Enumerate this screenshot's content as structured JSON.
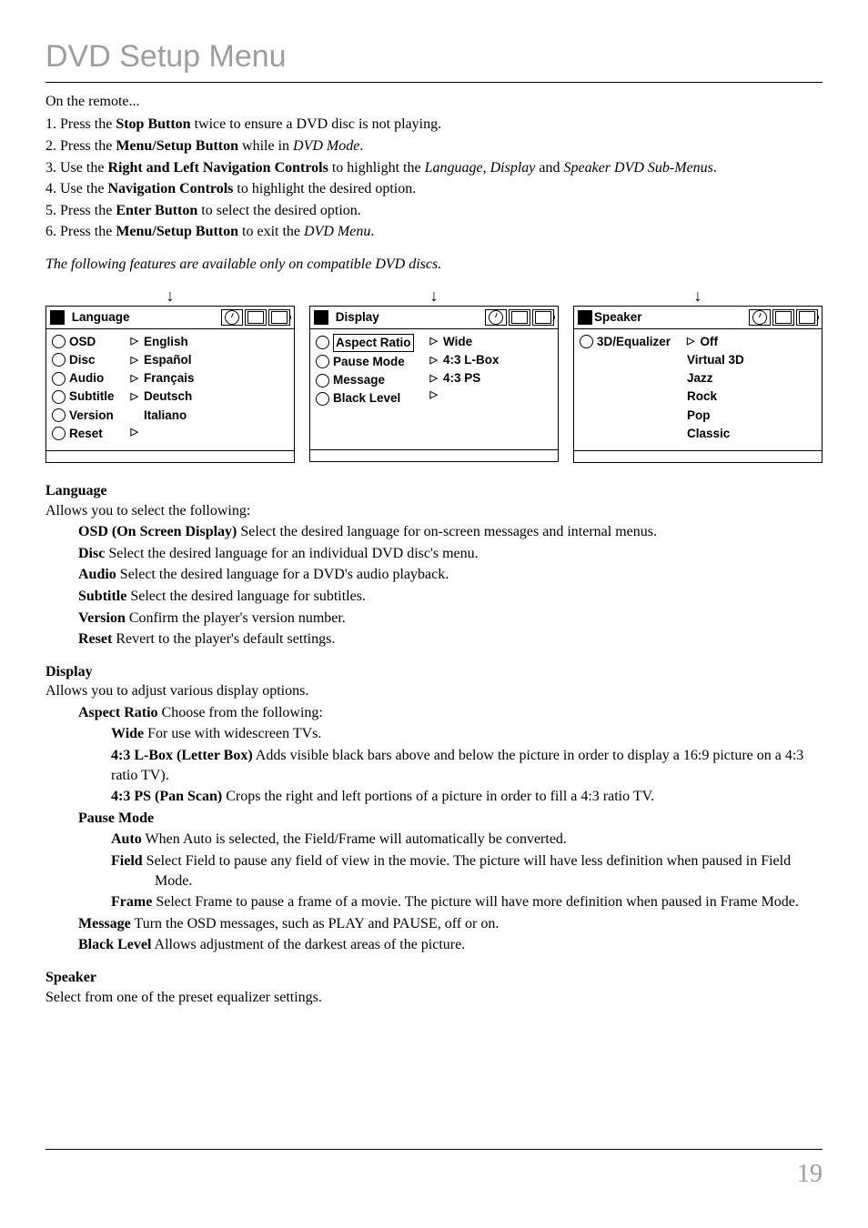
{
  "page": {
    "title": "DVD Setup Menu",
    "intro": "On the remote...",
    "steps": {
      "s1a": "1.  Press the ",
      "s1b": "Stop Button",
      "s1c": " twice to ensure a DVD disc is not playing.",
      "s2a": "2.  Press the ",
      "s2b": "Menu/Setup Button",
      "s2c": " while in ",
      "s2d": "DVD Mode",
      "s2e": ".",
      "s3a": "3.  Use the ",
      "s3b": "Right and Left Navigation Controls",
      "s3c": " to highlight the ",
      "s3d": "Language, Display",
      "s3e": " and ",
      "s3f": "Speaker DVD Sub-Menus",
      "s3g": ".",
      "s4a": "4.  Use the ",
      "s4b": "Navigation Controls",
      "s4c": " to highlight the desired option.",
      "s5a": "5.  Press the ",
      "s5b": "Enter Button",
      "s5c": " to select the desired option.",
      "s6a": "6.  Press the ",
      "s6b": "Menu/Setup Button",
      "s6c": " to exit the ",
      "s6d": "DVD Menu",
      "s6e": "."
    },
    "note": "The following features are available only on compatible DVD discs."
  },
  "panels": {
    "language": {
      "title": "Language",
      "left": [
        "OSD",
        "Disc",
        "Audio",
        "Subtitle",
        "Version",
        "Reset"
      ],
      "right": [
        "English",
        "Español",
        "Français",
        "Deutsch",
        "Italiano"
      ]
    },
    "display": {
      "title": "Display",
      "left": [
        "Aspect Ratio",
        "Pause Mode",
        "Message",
        "Black Level"
      ],
      "right": [
        "Wide",
        "4:3 L-Box",
        "4:3 PS",
        ""
      ]
    },
    "speaker": {
      "title": "Speaker",
      "left": [
        "3D/Equalizer"
      ],
      "right": [
        "Off",
        "Virtual 3D",
        "Jazz",
        "Rock",
        "Pop",
        "Classic"
      ]
    }
  },
  "sections": {
    "lang": {
      "h": "Language",
      "intro": "Allows you to select the following:",
      "osd_b": "OSD (On Screen Display)",
      "osd_t": "  Select the desired language for on-screen messages and internal menus.",
      "disc_b": "Disc",
      "disc_t": "  Select the desired language for an individual DVD disc's menu.",
      "audio_b": "Audio",
      "audio_t": "  Select the desired language for a DVD's audio playback.",
      "sub_b": "Subtitle",
      "sub_t": "  Select the desired language for subtitles.",
      "ver_b": "Version",
      "ver_t": "  Confirm the player's version number.",
      "rst_b": "Reset",
      "rst_t": "  Revert to the player's default settings."
    },
    "disp": {
      "h": "Display",
      "intro": "Allows you to adjust various display options.",
      "ar_b": "Aspect Ratio",
      "ar_t": "  Choose from the following:",
      "wide_b": "Wide",
      "wide_t": " For use with widescreen TVs.",
      "lb_b": "4:3 L-Box (Letter Box)",
      "lb_t": "  Adds visible black bars above and below the picture in order to display a 16:9 picture on a 4:3 ratio TV).",
      "ps_b": "4:3 PS (Pan Scan)",
      "ps_t": "  Crops the right and left portions of a picture in order to fill a 4:3 ratio TV.",
      "pm_b": "Pause Mode",
      "auto_b": "Auto",
      "auto_t": " When Auto is selected, the Field/Frame will automatically be converted.",
      "field_b": "Field",
      "field_t": " Select Field to pause any field of view in the movie.  The picture will have less definition when paused in Field Mode.",
      "frame_b": "Frame",
      "frame_t": " Select Frame to pause a frame of a movie.  The picture will have more definition when paused in Frame Mode.",
      "msg_b": "Message",
      "msg_t": "  Turn the OSD messages, such as PLAY and PAUSE, off or on.",
      "bl_b": "Black Level",
      "bl_t": "  Allows adjustment of the darkest areas of the picture."
    },
    "spk": {
      "h": "Speaker",
      "intro": "Select from one of the preset equalizer settings."
    }
  },
  "pagenum": "19"
}
